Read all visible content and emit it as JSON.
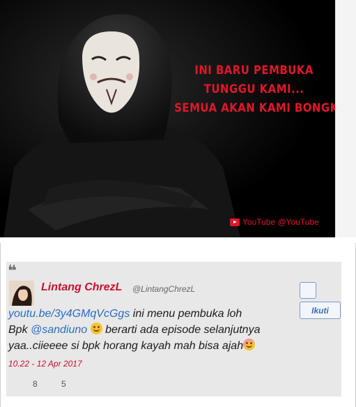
{
  "media": {
    "headline_lines": [
      "INI BARU PEMBUKA",
      "TUNGGU KAMI...",
      "SEMUA AKAN KAMI BONGKAR"
    ],
    "credit": "YouTube @YouTube"
  },
  "tweet": {
    "quote_mark": "❝",
    "author_name": "Lintang ChrezL",
    "author_handle": "@LintangChrezL",
    "follow_label": "Ikuti",
    "link_text": "youtu.be/3y4GMqVcGgs",
    "text_after_link": " ini menu pembuka loh",
    "line2_prefix": "Bpk ",
    "mention": "@sandiuno",
    "line2_suffix": " berarti ada episode selanjutnya",
    "line3": "yaa..ciieeee si bpk horang kayah mah bisa ajah",
    "timestamp": "10.22 - 12 Apr 2017",
    "retweets": "8",
    "likes": "5"
  },
  "colors": {
    "accent_red": "#e0172a",
    "link_blue": "#2a6cc1",
    "author_red": "#c8102e"
  },
  "icons": [
    "youtube-icon",
    "quote-icon",
    "smile-emoji",
    "wink-emoji"
  ]
}
